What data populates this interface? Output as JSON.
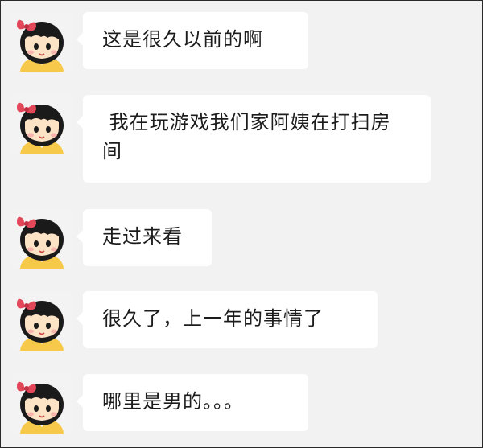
{
  "chat": {
    "messages": [
      {
        "text": "这是很久以前的啊"
      },
      {
        "text": " 我在玩游戏我们家阿姨在打扫房间"
      },
      {
        "text": "走过来看"
      },
      {
        "text": "很久了，上一年的事情了"
      },
      {
        "text": "哪里是男的。。。"
      }
    ]
  },
  "colors": {
    "background": "#f2f2f2",
    "bubble": "#ffffff",
    "text": "#1c1c1c",
    "avatar_hair": "#1a1a1a",
    "avatar_bow": "#e3485a",
    "avatar_skin": "#fde3c6",
    "avatar_shirt": "#f7c94a"
  },
  "icons": {
    "avatar": "cartoon-girl-avatar-icon"
  }
}
